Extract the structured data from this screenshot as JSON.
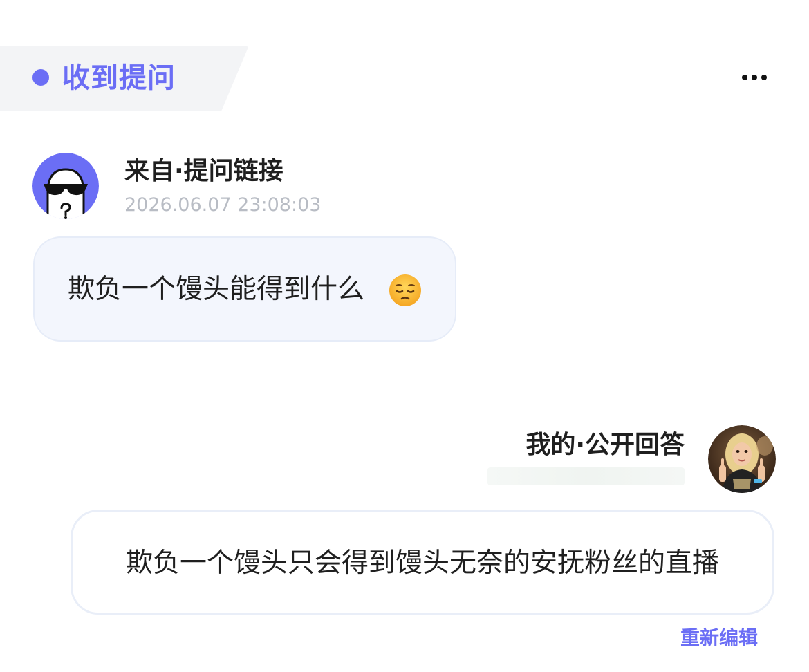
{
  "header": {
    "title": "收到提问",
    "accent_color": "#6b6ef5",
    "more_icon": "more-horizontal-icon"
  },
  "question": {
    "source_label": "来自·提问链接",
    "timestamp": "2026.06.07 23:08:03",
    "text": "欺负一个馒头能得到什么",
    "emoji": "pensive-face-emoji",
    "avatar": "anonymous-sunglasses-avatar"
  },
  "answer": {
    "label": "我的·公开回答",
    "text": "欺负一个馒头只会得到馒头无奈的安抚粉丝的直播",
    "avatar": "user-photo-avatar",
    "edit_label": "重新编辑"
  }
}
